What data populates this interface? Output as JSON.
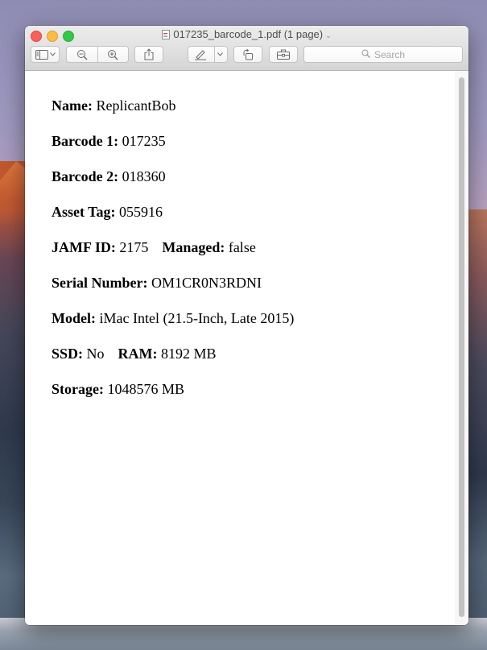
{
  "window": {
    "title": "017235_barcode_1.pdf (1 page)"
  },
  "toolbar": {
    "sidebar_button": "sidebar-toggle-icon",
    "zoom_out": "zoom-out-icon",
    "zoom_in": "zoom-in-icon",
    "share": "share-icon",
    "markup": "markup-pen-icon",
    "rotate": "rotate-icon",
    "toolbox": "toolbox-icon",
    "search_placeholder": "Search"
  },
  "document": {
    "name_label": "Name:",
    "name_value": "ReplicantBob",
    "barcode1_label": "Barcode 1:",
    "barcode1_value": "017235",
    "barcode2_label": "Barcode 2:",
    "barcode2_value": "018360",
    "asset_tag_label": "Asset Tag:",
    "asset_tag_value": "055916",
    "jamf_id_label": "JAMF ID:",
    "jamf_id_value": "2175",
    "managed_label": "Managed:",
    "managed_value": "false",
    "serial_label": "Serial Number:",
    "serial_value": "OM1CR0N3RDNI",
    "model_label": "Model:",
    "model_value": "iMac Intel (21.5-Inch, Late 2015)",
    "ssd_label": "SSD:",
    "ssd_value": "No",
    "ram_label": "RAM:",
    "ram_value": "8192 MB",
    "storage_label": "Storage:",
    "storage_value": "1048576 MB"
  },
  "colors": {
    "close": "#fc605c",
    "minimize": "#fdbc40",
    "maximize": "#34c84a"
  }
}
